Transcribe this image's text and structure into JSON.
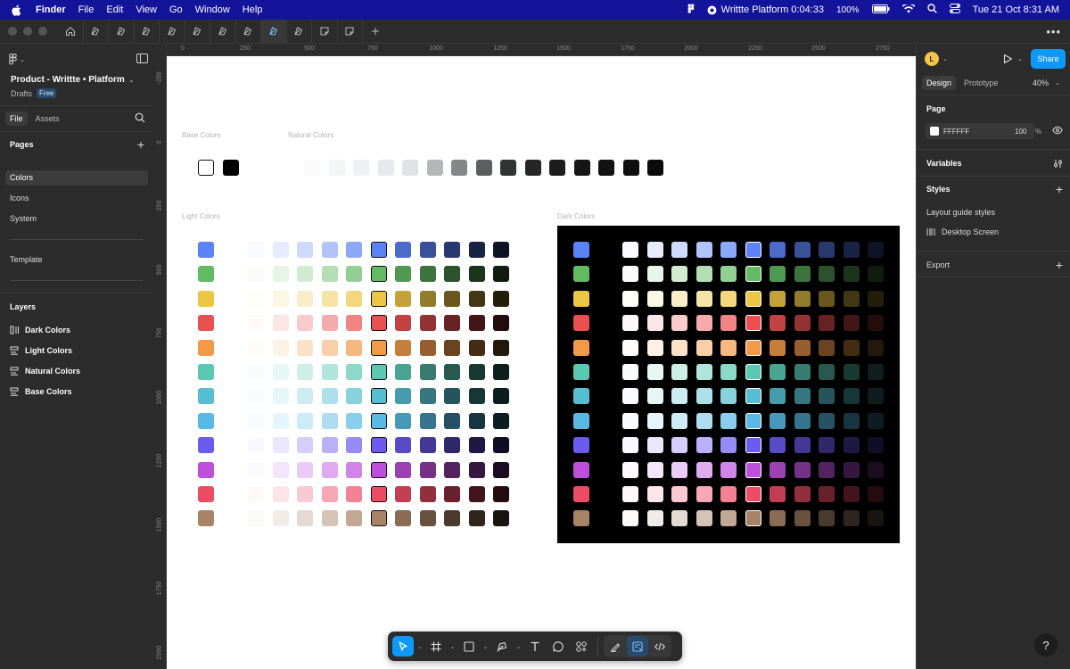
{
  "menubar": {
    "items": [
      "Finder",
      "File",
      "Edit",
      "View",
      "Go",
      "Window",
      "Help"
    ],
    "recording": "Writtte Platform 0:04:33",
    "battery": "100%",
    "datetime": "Tue 21 Oct  8:31 AM"
  },
  "left": {
    "file_title": "Product - Writtte • Platform",
    "drafts": "Drafts",
    "badge": "Free",
    "tab_file": "File",
    "tab_assets": "Assets",
    "pages_header": "Pages",
    "pages": [
      "Colors",
      "Icons",
      "System",
      "Template"
    ],
    "layers_header": "Layers",
    "layers": [
      "Dark Colors",
      "Light Colors",
      "Natural Colors",
      "Base Colors"
    ]
  },
  "rulers": {
    "top": [
      "0",
      "250",
      "500",
      "750",
      "1000",
      "1250",
      "1500",
      "1750",
      "2000",
      "2250",
      "2500",
      "2750"
    ],
    "left": [
      "-250",
      "0",
      "250",
      "500",
      "750",
      "1000",
      "1250",
      "1500",
      "1750",
      "2000"
    ]
  },
  "canvas": {
    "labels": {
      "base": "Base Colors",
      "natural": "Natural Colors",
      "light": "Light Colors",
      "dark": "Dark Colors"
    },
    "base_colors": [
      "#ffffff",
      "#000000"
    ],
    "natural_colors": [
      "#fafafa",
      "#f4f5f7",
      "#eef0f2",
      "#e7e9ec",
      "#e0e2e5",
      "#b6b7b9",
      "#858687",
      "#5d5e5f",
      "#323334",
      "#262626",
      "#1d1d1d",
      "#161616",
      "#121212",
      "#0f0f0f",
      "#0b0b0b"
    ],
    "hue_keys": [
      "#5b82f7",
      "#62bb63",
      "#ecc645",
      "#eb5050",
      "#f29a48",
      "#5ac8b3",
      "#55bed0",
      "#57b9e4",
      "#6b5bf0",
      "#bd4fdc",
      "#ec4c64",
      "#a88366"
    ]
  },
  "right": {
    "avatar": "L",
    "share": "Share",
    "tab_design": "Design",
    "tab_prototype": "Prototype",
    "zoom": "40%",
    "page_header": "Page",
    "page_color": "FFFFFF",
    "page_opacity": "100",
    "opacity_unit": "%",
    "variables": "Variables",
    "styles": "Styles",
    "layout_guide": "Layout guide styles",
    "desktop_screen": "Desktop Screen",
    "export": "Export",
    "help": "?"
  }
}
